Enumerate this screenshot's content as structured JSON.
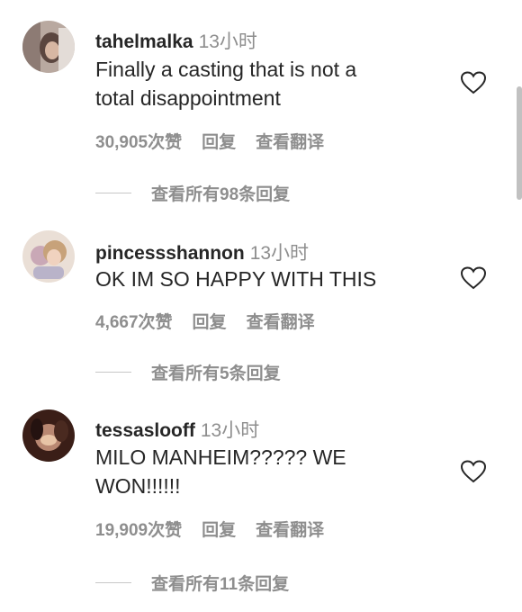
{
  "comments": [
    {
      "username": "tahelmalka",
      "time": "13小时",
      "text": "Finally a casting that is not a\ntotal disappointment",
      "likes": "30,905次赞",
      "reply": "回复",
      "translate": "查看翻译",
      "view_replies": "查看所有98条回复"
    },
    {
      "username": "pincessshannon",
      "time": "13小时",
      "text": "OK IM SO HAPPY WITH THIS",
      "likes": "4,667次赞",
      "reply": "回复",
      "translate": "查看翻译",
      "view_replies": "查看所有5条回复"
    },
    {
      "username": "tessaslooff",
      "time": "13小时",
      "text": "MILO MANHEIM????? WE\nWON!!!!!!",
      "likes": "19,909次赞",
      "reply": "回复",
      "translate": "查看翻译",
      "view_replies": "查看所有11条回复"
    }
  ],
  "colors": {
    "primary_text": "#262626",
    "secondary_text": "#8e8e8e",
    "divider": "#c7c7c7"
  },
  "icons": {
    "like": "heart-outline-icon"
  }
}
